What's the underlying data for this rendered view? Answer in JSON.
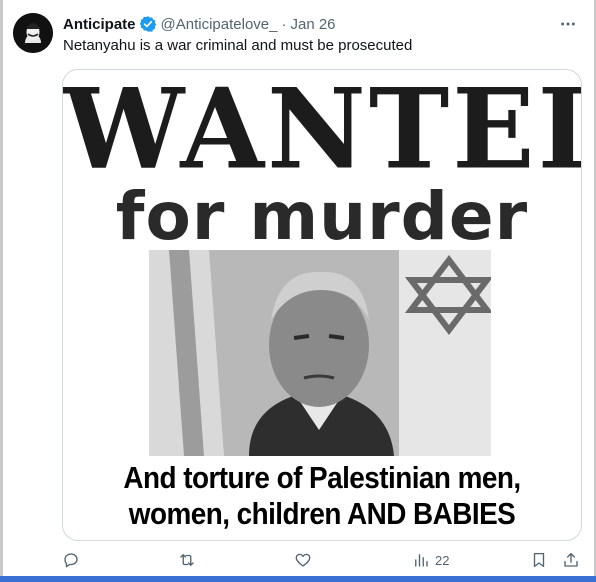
{
  "tweet": {
    "display_name": "Anticipate",
    "handle": "@Anticipatelove_",
    "separator": "·",
    "date": "Jan 26",
    "text": "Netanyahu is a war criminal and must be prosecuted"
  },
  "media": {
    "headline": "WANTED",
    "subheadline": "for murder",
    "caption_line1": "And torture of Palestinian men,",
    "caption_line2": "women, children AND BABIES"
  },
  "actions": {
    "views_count": "22"
  },
  "icons": {
    "verified": "verified-badge-icon",
    "more": "more-options-icon",
    "reply": "reply-icon",
    "retweet": "retweet-icon",
    "like": "like-icon",
    "views": "views-icon",
    "bookmark": "bookmark-icon",
    "share": "share-icon"
  },
  "colors": {
    "accent": "#1d9bf0",
    "secondary_text": "#536471",
    "primary_text": "#0f1419"
  }
}
